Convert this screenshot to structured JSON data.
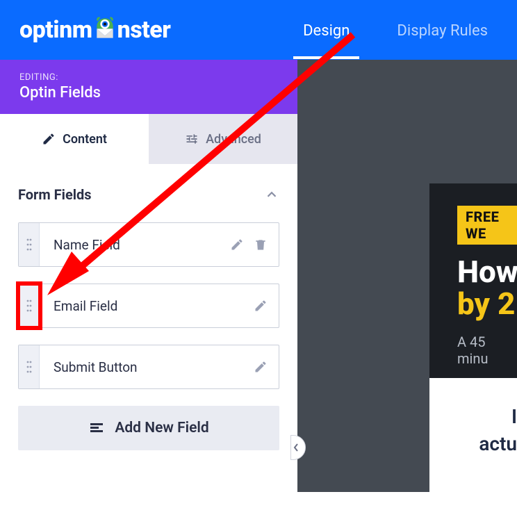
{
  "brand": {
    "prefix": "optinm",
    "suffix": "nster"
  },
  "nav": {
    "design": "Design",
    "display_rules": "Display Rules"
  },
  "editing": {
    "label": "EDITING:",
    "title": "Optin Fields"
  },
  "tabs": {
    "content": "Content",
    "advanced": "Advanced"
  },
  "section": {
    "title": "Form Fields"
  },
  "fields": [
    {
      "label": "Name Field",
      "deletable": true
    },
    {
      "label": "Email Field",
      "deletable": false
    },
    {
      "label": "Submit Button",
      "deletable": false
    }
  ],
  "add_label": "Add New Field",
  "preview": {
    "badge": "FREE WE",
    "line1": "How",
    "line2": "by 2",
    "sub": "A 45 minu",
    "white_line1": "I",
    "white_line2": "actu"
  }
}
